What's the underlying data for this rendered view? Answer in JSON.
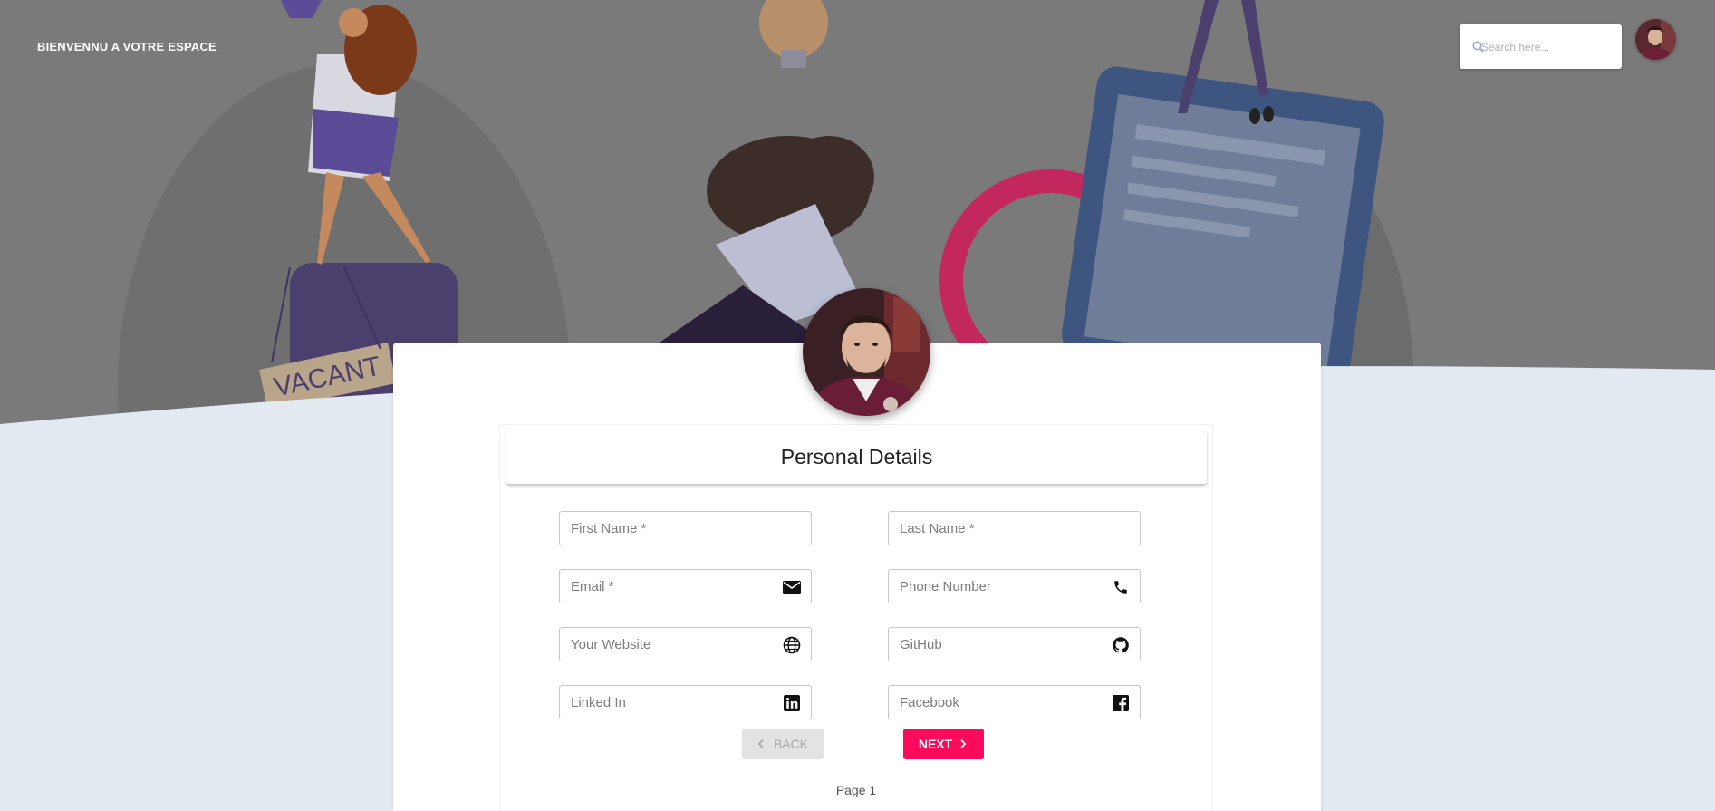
{
  "header": {
    "brand": "BIENVENNU A VOTRE ESPACE",
    "search_placeholder": "Search here..."
  },
  "hero": {
    "sign_text": "VACANT"
  },
  "form": {
    "title": "Personal Details",
    "fields": {
      "first_name": "First Name *",
      "last_name": "Last Name *",
      "email": "Email *",
      "phone": "Phone Number",
      "website": "Your Website",
      "github": "GitHub",
      "linkedin": "Linked In",
      "facebook": "Facebook"
    },
    "back_label": "BACK",
    "next_label": "NEXT",
    "page_label": "Page 1"
  },
  "colors": {
    "accent": "#fc0b5c",
    "hero_bg": "#7a7a7a",
    "page_bg": "#e3e9f1"
  }
}
